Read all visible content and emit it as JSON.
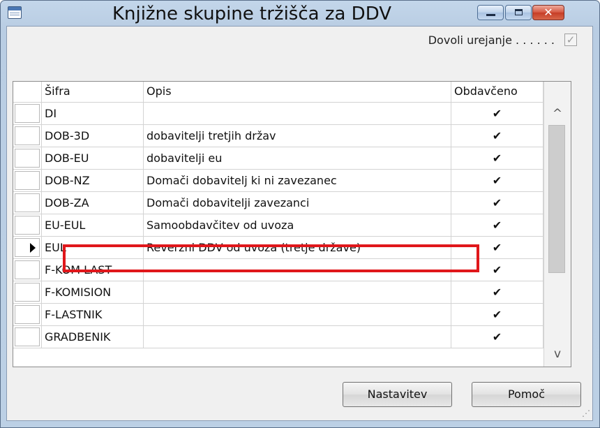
{
  "window": {
    "title": "Knjižne skupine tržišča za DDV",
    "minimize_glyph": "",
    "close_glyph": "✕"
  },
  "edit": {
    "label": "Dovoli urejanje . . . . . .",
    "checked": true,
    "check_glyph": "✓"
  },
  "table": {
    "columns": [
      "Šifra",
      "Opis",
      "Obdavčeno"
    ],
    "check_glyph": "✔",
    "rows": [
      {
        "code": "DI",
        "desc": "",
        "taxed": true
      },
      {
        "code": "DOB-3D",
        "desc": "dobavitelji tretjih držav",
        "taxed": true
      },
      {
        "code": "DOB-EU",
        "desc": "dobavitelji eu",
        "taxed": true
      },
      {
        "code": "DOB-NZ",
        "desc": "Domači dobavitelj ki ni zavezanec",
        "taxed": true
      },
      {
        "code": "DOB-ZA",
        "desc": "Domači dobavitelji zavezanci",
        "taxed": true
      },
      {
        "code": "EU-EUL",
        "desc": "Samoobdavčitev od uvoza",
        "taxed": true
      },
      {
        "code": "EUL",
        "desc": "Reverzni DDV od uvoza (tretje države)",
        "taxed": true,
        "current": true
      },
      {
        "code": "F-KOM LAST",
        "desc": "",
        "taxed": true
      },
      {
        "code": "F-KOMISION",
        "desc": "",
        "taxed": true
      },
      {
        "code": "F-LASTNIK",
        "desc": "",
        "taxed": true
      },
      {
        "code": "GRADBENIK",
        "desc": "",
        "taxed": true
      }
    ],
    "scroll_up_glyph": "^",
    "scroll_down_glyph": "v"
  },
  "buttons": {
    "setup": "Nastavitev",
    "help": "Pomoč"
  },
  "colors": {
    "highlight": "#e0171b",
    "titlebar": "#c3d6ea"
  }
}
